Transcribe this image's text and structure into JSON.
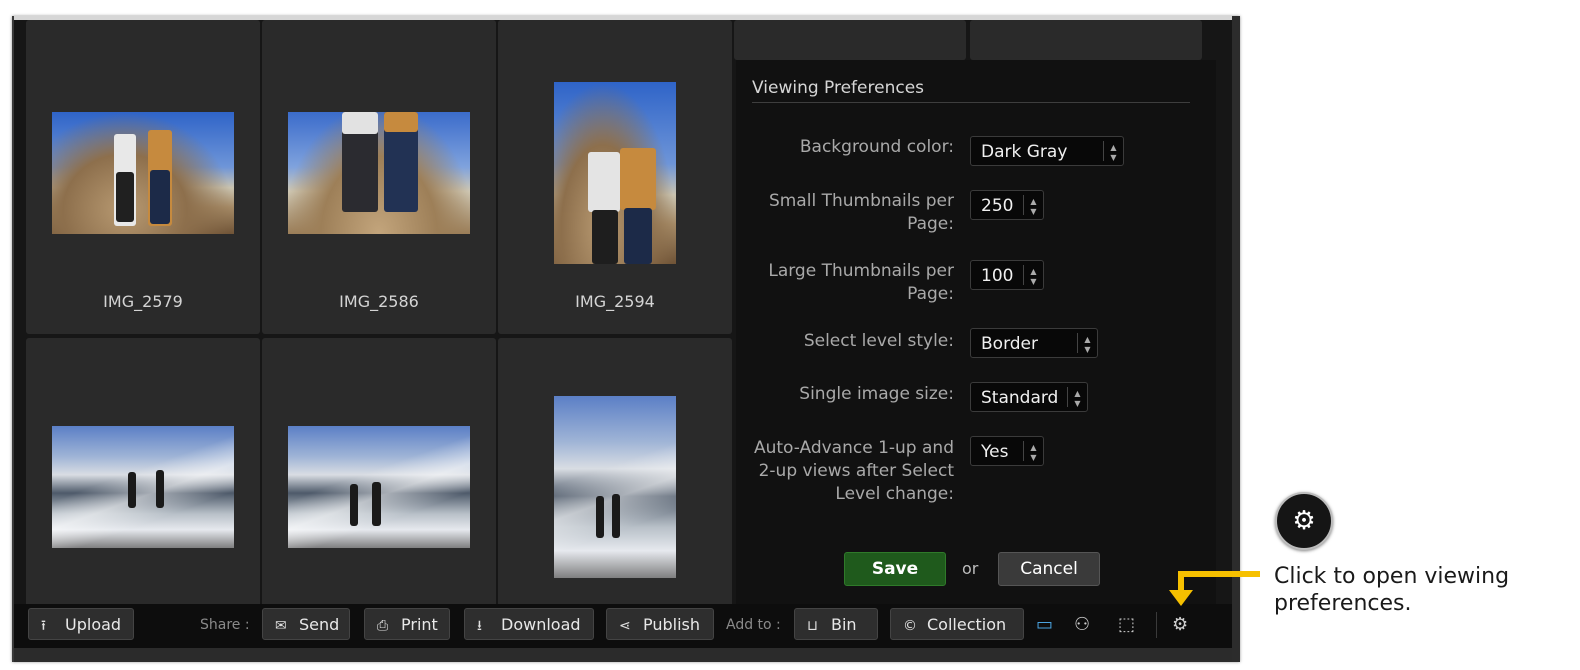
{
  "grid": {
    "items": [
      {
        "caption": "IMG_2579"
      },
      {
        "caption": "IMG_2586"
      },
      {
        "caption": "IMG_2594"
      },
      {
        "caption": ""
      },
      {
        "caption": ""
      },
      {
        "caption": ""
      }
    ]
  },
  "prefs": {
    "title": "Viewing Preferences",
    "fields": [
      {
        "label": "Background color:",
        "value": "Dark Gray"
      },
      {
        "label": "Small Thumbnails per Page:",
        "value": "250"
      },
      {
        "label": "Large Thumbnails per Page:",
        "value": "100"
      },
      {
        "label": "Select level style:",
        "value": "Border"
      },
      {
        "label": "Single image size:",
        "value": "Standard"
      },
      {
        "label": "Auto-Advance 1-up and 2-up views after Select Level change:",
        "value": "Yes"
      }
    ],
    "save_label": "Save",
    "or_text": "or",
    "cancel_label": "Cancel"
  },
  "toolbar": {
    "upload": "Upload",
    "share_label": "Share :",
    "send": "Send",
    "print": "Print",
    "download": "Download",
    "publish": "Publish",
    "add_to_label": "Add to :",
    "bin": "Bin",
    "collection": "Collection"
  },
  "callout": {
    "text": "Click to open viewing preferences.",
    "icon": "gear-icon",
    "arrow_color": "#f6c000"
  }
}
